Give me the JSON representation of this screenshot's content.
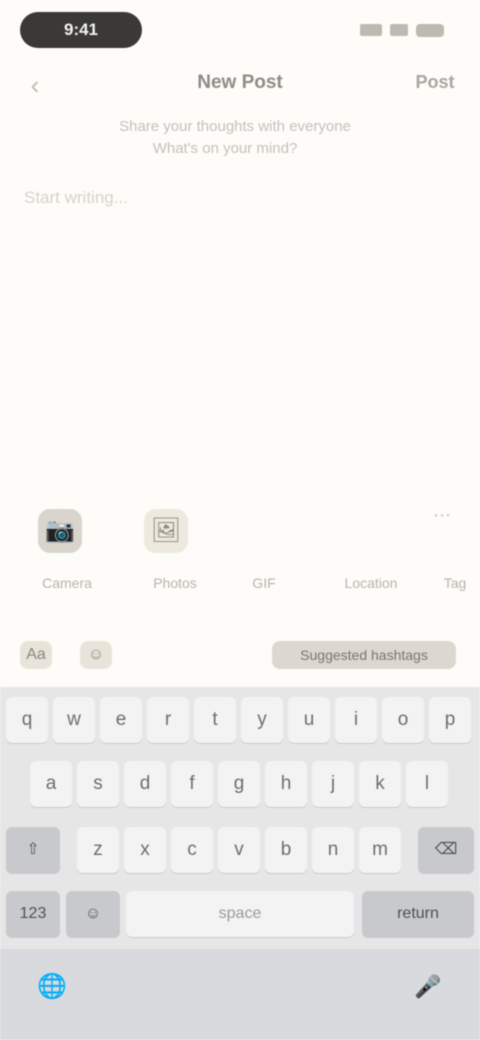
{
  "status_bar": {
    "time": "9:41",
    "icons": [
      "signal-icon",
      "wifi-icon",
      "battery-icon"
    ]
  },
  "header": {
    "back_glyph": "‹",
    "title": "New Post",
    "done_label": "Post",
    "prompt_line_1": "Share your thoughts with everyone",
    "prompt_line_2": "What's on your mind?"
  },
  "editor": {
    "placeholder": "Start writing..."
  },
  "media": {
    "camera_glyph": "📷",
    "gallery_glyph": "🖼",
    "more_glyph": "⋯",
    "labels": [
      "Camera",
      "Photos",
      "GIF",
      "Location",
      "Tag"
    ]
  },
  "suggestions": {
    "icon_1": "Aa",
    "icon_2": "☺",
    "pill_label": "Suggested hashtags"
  },
  "keyboard": {
    "row1": [
      "q",
      "w",
      "e",
      "r",
      "t",
      "y",
      "u",
      "i",
      "o",
      "p"
    ],
    "row2": [
      "a",
      "s",
      "d",
      "f",
      "g",
      "h",
      "j",
      "k",
      "l"
    ],
    "row3": [
      "z",
      "x",
      "c",
      "v",
      "b",
      "n",
      "m"
    ],
    "shift": "⇧",
    "backspace": "⌫",
    "numbers": "123",
    "emoji": "☺",
    "space": "space",
    "return": "return",
    "globe": "🌐",
    "mic": "🎤"
  },
  "colors": {
    "background": "#fdfcf8",
    "keyboard": "#e7e6e7",
    "time_pill": "#3a3936"
  }
}
